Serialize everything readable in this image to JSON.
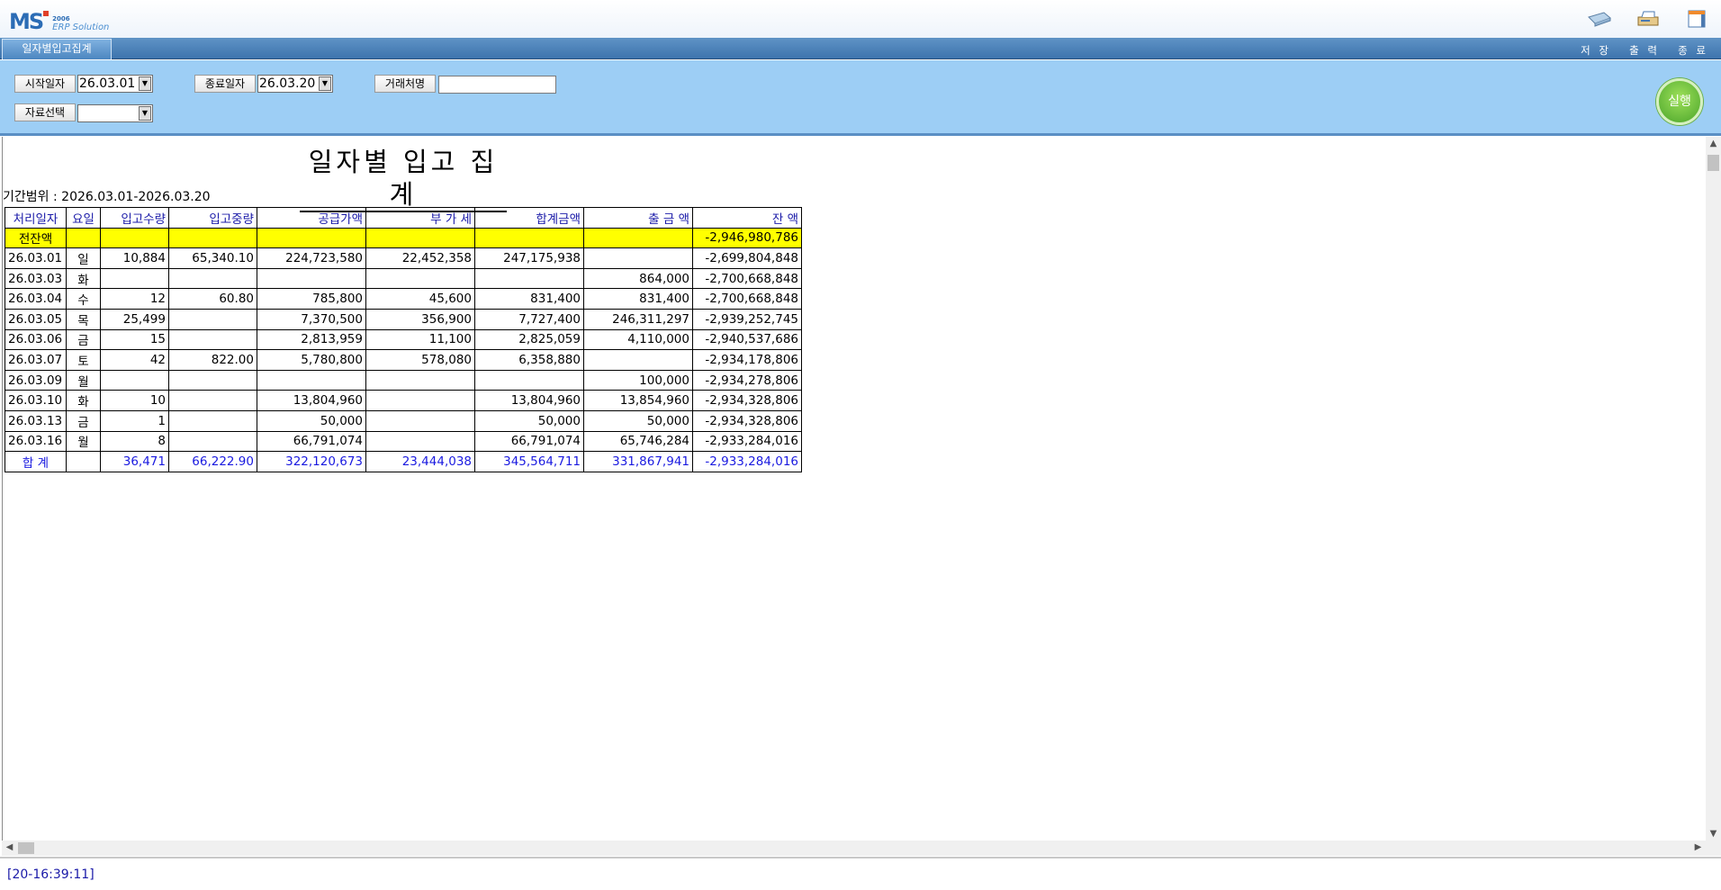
{
  "header": {
    "logo_text": "MS",
    "logo_year": "2006",
    "logo_line1": "ERP",
    "logo_line2": "Solution",
    "icons": [
      "save-icon",
      "print-icon",
      "exit-icon"
    ]
  },
  "tabbar": {
    "tab_label": "일자별입고집계",
    "actions": {
      "save": "저 장",
      "print": "출 력",
      "exit": "종 료"
    }
  },
  "filter": {
    "start_date_label": "시작일자",
    "start_date_value": "26.03.01",
    "end_date_label": "종료일자",
    "end_date_value": "26.03.20",
    "vendor_label": "거래처명",
    "vendor_value": "",
    "data_select_label": "자료선택",
    "data_select_value": "",
    "run_label": "실행"
  },
  "report": {
    "title": "일자별 입고 집계",
    "period_label": "기간범위",
    "period_value": "2026.03.01-2026.03.20",
    "columns": [
      "처리일자",
      "요일",
      "입고수량",
      "입고중량",
      "공급가액",
      "부 가 세",
      "합계금액",
      "출 금 액",
      "잔      액"
    ],
    "opening_row": [
      "전잔액",
      "",
      "",
      "",
      "",
      "",
      "",
      "",
      "-2,946,980,786"
    ],
    "rows": [
      [
        "26.03.01",
        "일",
        "10,884",
        "65,340.10",
        "224,723,580",
        "22,452,358",
        "247,175,938",
        "",
        "-2,699,804,848"
      ],
      [
        "26.03.03",
        "화",
        "",
        "",
        "",
        "",
        "",
        "864,000",
        "-2,700,668,848"
      ],
      [
        "26.03.04",
        "수",
        "12",
        "60.80",
        "785,800",
        "45,600",
        "831,400",
        "831,400",
        "-2,700,668,848"
      ],
      [
        "26.03.05",
        "목",
        "25,499",
        "",
        "7,370,500",
        "356,900",
        "7,727,400",
        "246,311,297",
        "-2,939,252,745"
      ],
      [
        "26.03.06",
        "금",
        "15",
        "",
        "2,813,959",
        "11,100",
        "2,825,059",
        "4,110,000",
        "-2,940,537,686"
      ],
      [
        "26.03.07",
        "토",
        "42",
        "822.00",
        "5,780,800",
        "578,080",
        "6,358,880",
        "",
        "-2,934,178,806"
      ],
      [
        "26.03.09",
        "월",
        "",
        "",
        "",
        "",
        "",
        "100,000",
        "-2,934,278,806"
      ],
      [
        "26.03.10",
        "화",
        "10",
        "",
        "13,804,960",
        "",
        "13,804,960",
        "13,854,960",
        "-2,934,328,806"
      ],
      [
        "26.03.13",
        "금",
        "1",
        "",
        "50,000",
        "",
        "50,000",
        "50,000",
        "-2,934,328,806"
      ],
      [
        "26.03.16",
        "월",
        "8",
        "",
        "66,791,074",
        "",
        "66,791,074",
        "65,746,284",
        "-2,933,284,016"
      ]
    ],
    "total_row": [
      "합  계",
      "",
      "36,471",
      "66,222.90",
      "322,120,673",
      "23,444,038",
      "345,564,711",
      "331,867,941",
      "-2,933,284,016"
    ]
  },
  "status": {
    "text": "[20-16:39:11]"
  },
  "colors": {
    "accent": "#3e74ad",
    "filter_bg": "#9dcef5",
    "header_text": "#1a1aa8",
    "highlight": "#ffff00"
  }
}
